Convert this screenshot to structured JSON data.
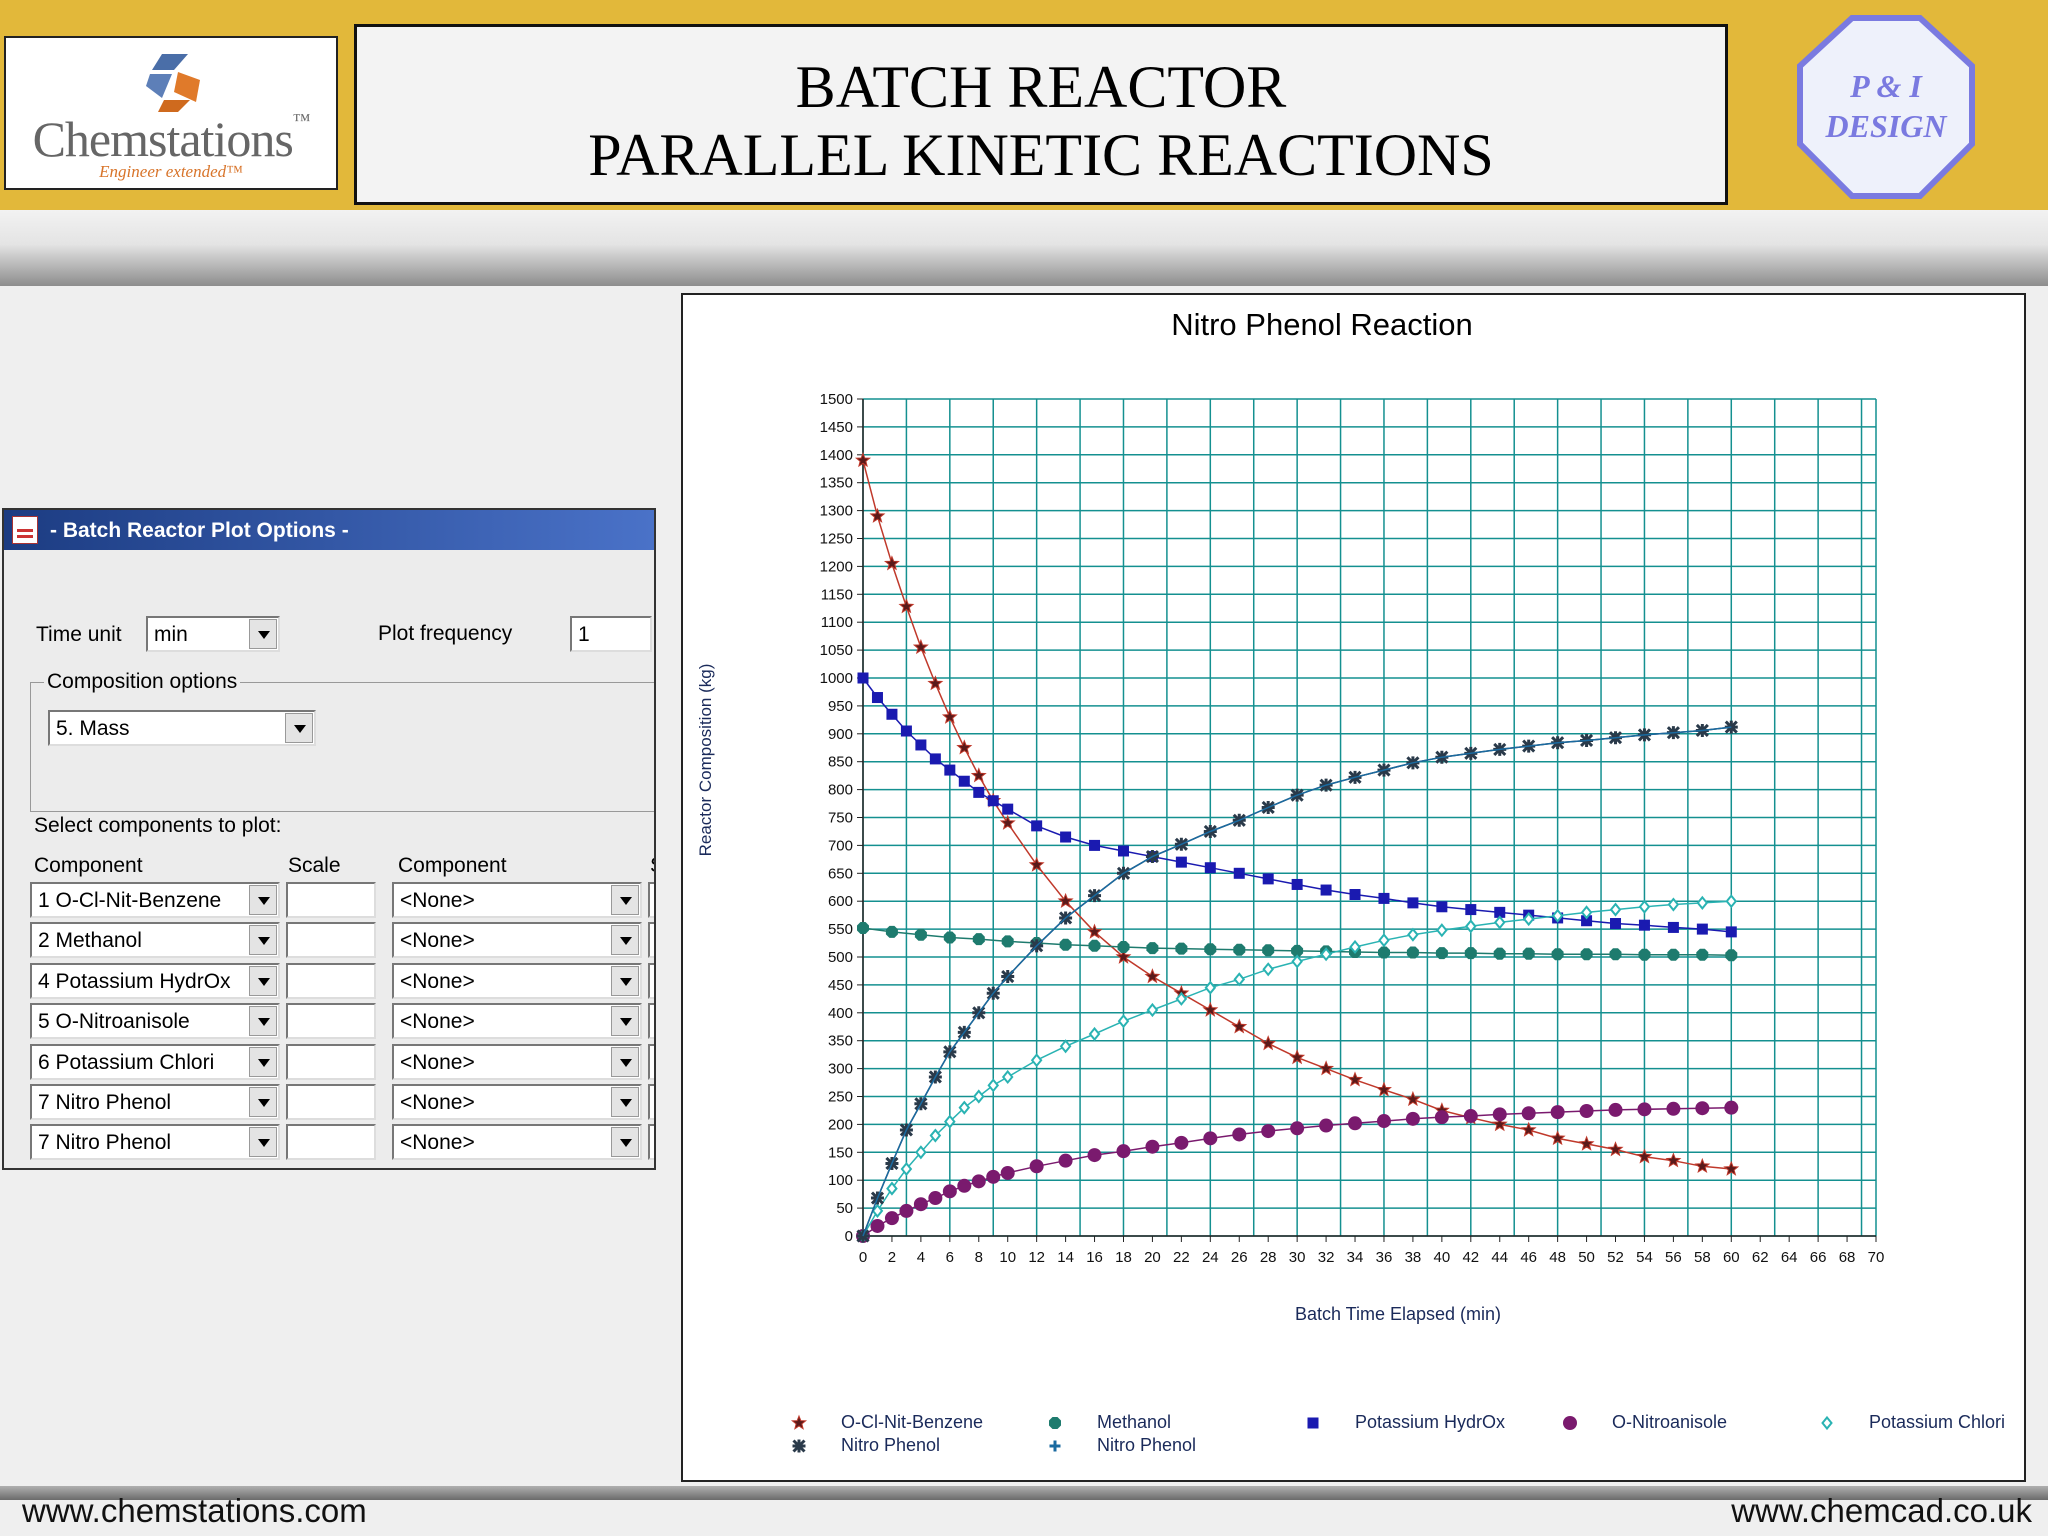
{
  "header": {
    "logo_name": "Chemstations",
    "logo_tm": "™",
    "logo_tagline": "Engineer extended™",
    "title_line1": "BATCH REACTOR",
    "title_line2": "PARALLEL KINETIC REACTIONS",
    "badge_line1": "P & I",
    "badge_line2": "DESIGN"
  },
  "dialog": {
    "title": "- Batch Reactor Plot Options -",
    "time_unit_label": "Time unit",
    "time_unit_value": "min",
    "plot_frequency_label": "Plot frequency",
    "plot_frequency_value": "1",
    "composition_group_label": "Composition options",
    "composition_value": "5.  Mass",
    "select_label": "Select components to plot:",
    "col_component": "Component",
    "col_scale": "Scale",
    "col_component2": "Component",
    "col_partial": "S",
    "rows": [
      {
        "component": "1 O-Cl-Nit-Benzene",
        "scale": "",
        "component2": "<None>"
      },
      {
        "component": "2 Methanol",
        "scale": "",
        "component2": "<None>"
      },
      {
        "component": "4 Potassium HydrOx",
        "scale": "",
        "component2": "<None>"
      },
      {
        "component": "5 O-Nitroanisole",
        "scale": "",
        "component2": "<None>"
      },
      {
        "component": "6 Potassium Chlori",
        "scale": "",
        "component2": "<None>"
      },
      {
        "component": "7 Nitro Phenol",
        "scale": "",
        "component2": "<None>"
      },
      {
        "component": "7 Nitro Phenol",
        "scale": "",
        "component2": "<None>"
      }
    ]
  },
  "chart_data": {
    "type": "line",
    "title": "Nitro Phenol Reaction",
    "xlabel": "Batch Time Elapsed (min)",
    "ylabel": "Reactor Composition (kg)",
    "xlim": [
      0,
      70
    ],
    "ylim": [
      0,
      1500
    ],
    "x_ticks": [
      0,
      2,
      4,
      6,
      8,
      10,
      12,
      14,
      16,
      18,
      20,
      22,
      24,
      26,
      28,
      30,
      32,
      34,
      36,
      38,
      40,
      42,
      44,
      46,
      48,
      50,
      52,
      54,
      56,
      58,
      60,
      62,
      64,
      66,
      68,
      70
    ],
    "y_ticks": [
      0,
      50,
      100,
      150,
      200,
      250,
      300,
      350,
      400,
      450,
      500,
      550,
      600,
      650,
      700,
      750,
      800,
      850,
      900,
      950,
      1000,
      1050,
      1100,
      1150,
      1200,
      1250,
      1300,
      1350,
      1400,
      1450,
      1500
    ],
    "x_grid_step": 3,
    "grid": true,
    "legend_position": "bottom",
    "series": [
      {
        "name": "O-Cl-Nit-Benzene",
        "color": "#c0392b",
        "marker": "star",
        "x": [
          0,
          1,
          2,
          3,
          4,
          5,
          6,
          7,
          8,
          9,
          10,
          12,
          14,
          16,
          18,
          20,
          22,
          24,
          26,
          28,
          30,
          32,
          34,
          36,
          38,
          40,
          42,
          44,
          46,
          48,
          50,
          52,
          54,
          56,
          58,
          60
        ],
        "y": [
          1390,
          1290,
          1205,
          1128,
          1055,
          990,
          930,
          875,
          825,
          780,
          740,
          665,
          600,
          545,
          500,
          465,
          435,
          405,
          375,
          345,
          320,
          300,
          280,
          262,
          245,
          225,
          212,
          200,
          190,
          175,
          165,
          155,
          142,
          135,
          125,
          120
        ]
      },
      {
        "name": "Methanol",
        "color": "#1e7b6e",
        "marker": "octagon",
        "x": [
          0,
          2,
          4,
          6,
          8,
          10,
          12,
          14,
          16,
          18,
          20,
          22,
          24,
          26,
          28,
          30,
          32,
          34,
          36,
          38,
          40,
          42,
          44,
          46,
          48,
          50,
          52,
          54,
          56,
          58,
          60
        ],
        "y": [
          552,
          545,
          540,
          535,
          532,
          528,
          525,
          522,
          520,
          518,
          516,
          515,
          514,
          513,
          512,
          511,
          510,
          509,
          508,
          508,
          507,
          507,
          506,
          506,
          505,
          505,
          505,
          504,
          504,
          504,
          503
        ]
      },
      {
        "name": "Potassium HydrOx",
        "color": "#1a1ab0",
        "marker": "square",
        "x": [
          0,
          1,
          2,
          3,
          4,
          5,
          6,
          7,
          8,
          9,
          10,
          12,
          14,
          16,
          18,
          20,
          22,
          24,
          26,
          28,
          30,
          32,
          34,
          36,
          38,
          40,
          42,
          44,
          46,
          48,
          50,
          52,
          54,
          56,
          58,
          60
        ],
        "y": [
          1000,
          965,
          935,
          905,
          880,
          855,
          835,
          815,
          795,
          780,
          765,
          735,
          715,
          700,
          690,
          680,
          670,
          660,
          650,
          640,
          630,
          620,
          612,
          605,
          597,
          590,
          585,
          580,
          575,
          570,
          565,
          560,
          557,
          553,
          550,
          545
        ]
      },
      {
        "name": "O-Nitroanisole",
        "color": "#7a1a6e",
        "marker": "circle",
        "x": [
          0,
          1,
          2,
          3,
          4,
          5,
          6,
          7,
          8,
          9,
          10,
          12,
          14,
          16,
          18,
          20,
          22,
          24,
          26,
          28,
          30,
          32,
          34,
          36,
          38,
          40,
          42,
          44,
          46,
          48,
          50,
          52,
          54,
          56,
          58,
          60
        ],
        "y": [
          0,
          18,
          32,
          45,
          57,
          68,
          80,
          90,
          98,
          106,
          113,
          125,
          135,
          145,
          152,
          160,
          167,
          175,
          182,
          188,
          193,
          198,
          202,
          206,
          210,
          213,
          215,
          218,
          220,
          222,
          224,
          226,
          227,
          228,
          229,
          230
        ]
      },
      {
        "name": "Potassium Chlori",
        "color": "#2ab3b3",
        "marker": "diamond",
        "x": [
          0,
          1,
          2,
          3,
          4,
          5,
          6,
          7,
          8,
          9,
          10,
          12,
          14,
          16,
          18,
          20,
          22,
          24,
          26,
          28,
          30,
          32,
          34,
          36,
          38,
          40,
          42,
          44,
          46,
          48,
          50,
          52,
          54,
          56,
          58,
          60
        ],
        "y": [
          0,
          45,
          85,
          120,
          150,
          180,
          205,
          230,
          250,
          270,
          285,
          315,
          340,
          362,
          385,
          405,
          425,
          445,
          460,
          478,
          492,
          505,
          518,
          530,
          540,
          548,
          555,
          562,
          568,
          574,
          580,
          585,
          590,
          594,
          597,
          600
        ]
      },
      {
        "name": "Nitro Phenol",
        "color": "#2a3a4a",
        "marker": "x",
        "x": [
          0,
          1,
          2,
          3,
          4,
          5,
          6,
          7,
          8,
          9,
          10,
          12,
          14,
          16,
          18,
          20,
          22,
          24,
          26,
          28,
          30,
          32,
          34,
          36,
          38,
          40,
          42,
          44,
          46,
          48,
          50,
          52,
          54,
          56,
          58,
          60
        ],
        "y": [
          0,
          68,
          130,
          190,
          237,
          285,
          330,
          365,
          400,
          435,
          465,
          520,
          570,
          610,
          650,
          680,
          702,
          725,
          745,
          768,
          790,
          808,
          822,
          835,
          848,
          858,
          865,
          872,
          878,
          884,
          888,
          893,
          898,
          902,
          906,
          912
        ]
      },
      {
        "name": "Nitro Phenol",
        "color": "#1a6aa0",
        "marker": "plus",
        "x": [
          0,
          1,
          2,
          3,
          4,
          5,
          6,
          7,
          8,
          9,
          10,
          12,
          14,
          16,
          18,
          20,
          22,
          24,
          26,
          28,
          30,
          32,
          34,
          36,
          38,
          40,
          42,
          44,
          46,
          48,
          50,
          52,
          54,
          56,
          58,
          60
        ],
        "y": [
          0,
          68,
          130,
          190,
          237,
          285,
          330,
          365,
          400,
          435,
          465,
          520,
          570,
          610,
          650,
          680,
          702,
          725,
          745,
          768,
          790,
          808,
          822,
          835,
          848,
          858,
          865,
          872,
          878,
          884,
          888,
          893,
          898,
          902,
          906,
          912
        ]
      }
    ]
  },
  "footer": {
    "left_url": "www.chemstations.com",
    "right_url": "www.chemcad.co.uk"
  }
}
